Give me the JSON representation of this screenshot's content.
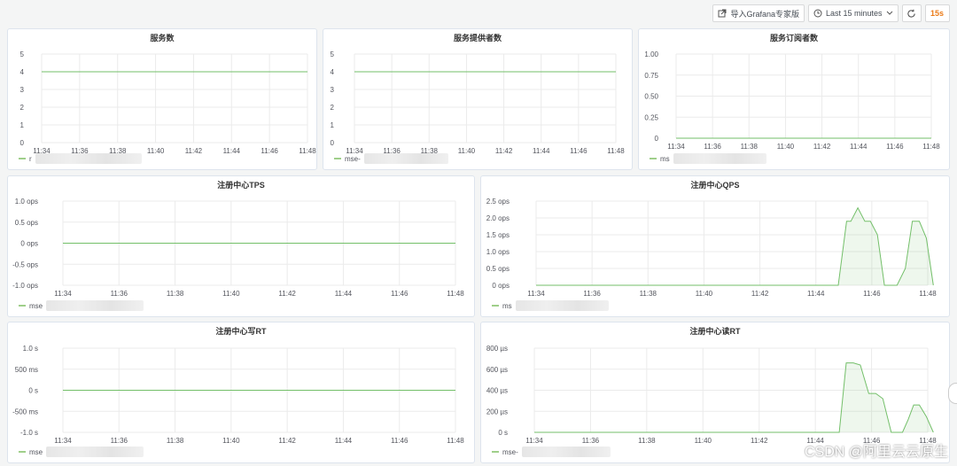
{
  "toolbar": {
    "import_label": "导入Grafana专家版",
    "time_range": "Last 15 minutes",
    "refresh_interval": "15s"
  },
  "accent_color": "#73bf69",
  "panels": [
    {
      "id": "p1",
      "title": "服务数",
      "legend_prefix": "r",
      "chart_data": {
        "type": "line",
        "title": "服务数",
        "x": [
          "11:34",
          "11:36",
          "11:38",
          "11:40",
          "11:42",
          "11:44",
          "11:46",
          "11:48"
        ],
        "y_ticks": [
          "0",
          "1",
          "2",
          "3",
          "4",
          "5"
        ],
        "ylim": [
          0,
          5
        ],
        "series": [
          {
            "values": [
              4,
              4,
              4,
              4,
              4,
              4,
              4,
              4
            ]
          }
        ]
      }
    },
    {
      "id": "p2",
      "title": "服务提供者数",
      "legend_prefix": "mse-",
      "chart_data": {
        "type": "line",
        "title": "服务提供者数",
        "x": [
          "11:34",
          "11:36",
          "11:38",
          "11:40",
          "11:42",
          "11:44",
          "11:46",
          "11:48"
        ],
        "y_ticks": [
          "0",
          "1",
          "2",
          "3",
          "4",
          "5"
        ],
        "ylim": [
          0,
          5
        ],
        "series": [
          {
            "values": [
              4,
              4,
              4,
              4,
              4,
              4,
              4,
              4
            ]
          }
        ]
      }
    },
    {
      "id": "p3",
      "title": "服务订阅者数",
      "legend_prefix": "ms",
      "chart_data": {
        "type": "line",
        "title": "服务订阅者数",
        "x": [
          "11:34",
          "11:36",
          "11:38",
          "11:40",
          "11:42",
          "11:44",
          "11:46",
          "11:48"
        ],
        "y_ticks": [
          "0",
          "0.25",
          "0.50",
          "0.75",
          "1.00"
        ],
        "ylim": [
          0,
          1
        ],
        "series": [
          {
            "values": [
              0,
              0,
              0,
              0,
              0,
              0,
              0,
              0
            ]
          }
        ]
      }
    },
    {
      "id": "p4",
      "title": "注册中心TPS",
      "legend_prefix": "mse",
      "chart_data": {
        "type": "line",
        "title": "注册中心TPS",
        "x": [
          "11:34",
          "11:36",
          "11:38",
          "11:40",
          "11:42",
          "11:44",
          "11:46",
          "11:48"
        ],
        "y_ticks": [
          "-1.0 ops",
          "-0.5 ops",
          "0 ops",
          "0.5 ops",
          "1.0 ops"
        ],
        "ylim": [
          -1,
          1
        ],
        "series": [
          {
            "values": [
              0,
              0,
              0,
              0,
              0,
              0,
              0,
              0
            ]
          }
        ]
      }
    },
    {
      "id": "p5",
      "title": "注册中心QPS",
      "legend_prefix": "ms",
      "chart_data": {
        "type": "area",
        "title": "注册中心QPS",
        "x": [
          "11:34",
          "11:36",
          "11:38",
          "11:40",
          "11:42",
          "11:44",
          "11:46",
          "11:48"
        ],
        "y_ticks": [
          "0 ops",
          "0.5 ops",
          "1.0 ops",
          "1.5 ops",
          "2.0 ops",
          "2.5 ops"
        ],
        "ylim": [
          0,
          2.5
        ],
        "series": [
          {
            "points": [
              [
                0,
                0
              ],
              [
                10.8,
                0
              ],
              [
                11.1,
                1.9
              ],
              [
                11.25,
                1.9
              ],
              [
                11.5,
                2.3
              ],
              [
                11.75,
                1.9
              ],
              [
                11.95,
                1.9
              ],
              [
                12.2,
                1.5
              ],
              [
                12.45,
                0
              ],
              [
                12.9,
                0
              ],
              [
                13.2,
                0.5
              ],
              [
                13.45,
                1.9
              ],
              [
                13.7,
                1.9
              ],
              [
                13.95,
                1.4
              ],
              [
                14.2,
                0
              ]
            ]
          }
        ]
      }
    },
    {
      "id": "p6",
      "title": "注册中心写RT",
      "legend_prefix": "mse",
      "chart_data": {
        "type": "line",
        "title": "注册中心写RT",
        "x": [
          "11:34",
          "11:36",
          "11:38",
          "11:40",
          "11:42",
          "11:44",
          "11:46",
          "11:48"
        ],
        "y_ticks": [
          "-1.0 s",
          "-500 ms",
          "0 s",
          "500 ms",
          "1.0 s"
        ],
        "ylim": [
          -1,
          1
        ],
        "series": [
          {
            "values": [
              0,
              0,
              0,
              0,
              0,
              0,
              0,
              0
            ]
          }
        ]
      }
    },
    {
      "id": "p7",
      "title": "注册中心读RT",
      "legend_prefix": "mse-",
      "chart_data": {
        "type": "area",
        "title": "注册中心读RT",
        "x": [
          "11:34",
          "11:36",
          "11:38",
          "11:40",
          "11:42",
          "11:44",
          "11:46",
          "11:48"
        ],
        "y_ticks": [
          "0 s",
          "200 µs",
          "400 µs",
          "600 µs",
          "800 µs"
        ],
        "ylim": [
          0,
          800
        ],
        "series": [
          {
            "points": [
              [
                0,
                0
              ],
              [
                10.85,
                0
              ],
              [
                11.1,
                660
              ],
              [
                11.35,
                660
              ],
              [
                11.6,
                640
              ],
              [
                11.9,
                370
              ],
              [
                12.15,
                370
              ],
              [
                12.4,
                320
              ],
              [
                12.7,
                0
              ],
              [
                13.1,
                0
              ],
              [
                13.3,
                120
              ],
              [
                13.5,
                260
              ],
              [
                13.7,
                260
              ],
              [
                13.95,
                150
              ],
              [
                14.2,
                0
              ]
            ]
          }
        ]
      }
    }
  ],
  "watermark": "CSDN @阿里云云原生"
}
